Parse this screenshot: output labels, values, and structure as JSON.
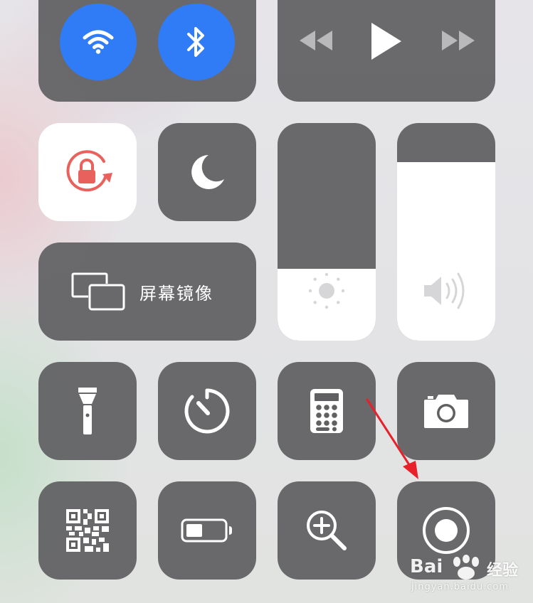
{
  "screen_mirroring": {
    "label": "屏幕镜像"
  },
  "sliders": {
    "brightness": {
      "level": 0.33
    },
    "volume": {
      "level": 0.82
    }
  },
  "watermark": {
    "brand": "Bai",
    "brand_suffix": "经验",
    "url": "jingyan.baidu.com"
  },
  "icons": {
    "wifi": "wifi-icon",
    "bluetooth": "bluetooth-icon",
    "rewind": "rewind-icon",
    "play": "play-icon",
    "fast_forward": "fast-forward-icon",
    "rotation_lock": "rotation-lock-icon",
    "do_not_disturb": "moon-icon",
    "screen_mirroring": "screen-mirroring-icon",
    "brightness": "sun-icon",
    "volume": "speaker-icon",
    "flashlight": "flashlight-icon",
    "timer": "timer-icon",
    "calculator": "calculator-icon",
    "camera": "camera-icon",
    "qr_scanner": "qr-code-icon",
    "low_power": "battery-icon",
    "magnifier": "magnifier-icon",
    "screen_recording": "screen-record-icon",
    "annotation": "red-arrow-icon"
  },
  "colors": {
    "accent_blue": "#2f7cf6",
    "tile_gray": "#606062",
    "rotation_lock_red": "#e9615c",
    "arrow_red": "#e8202a"
  }
}
